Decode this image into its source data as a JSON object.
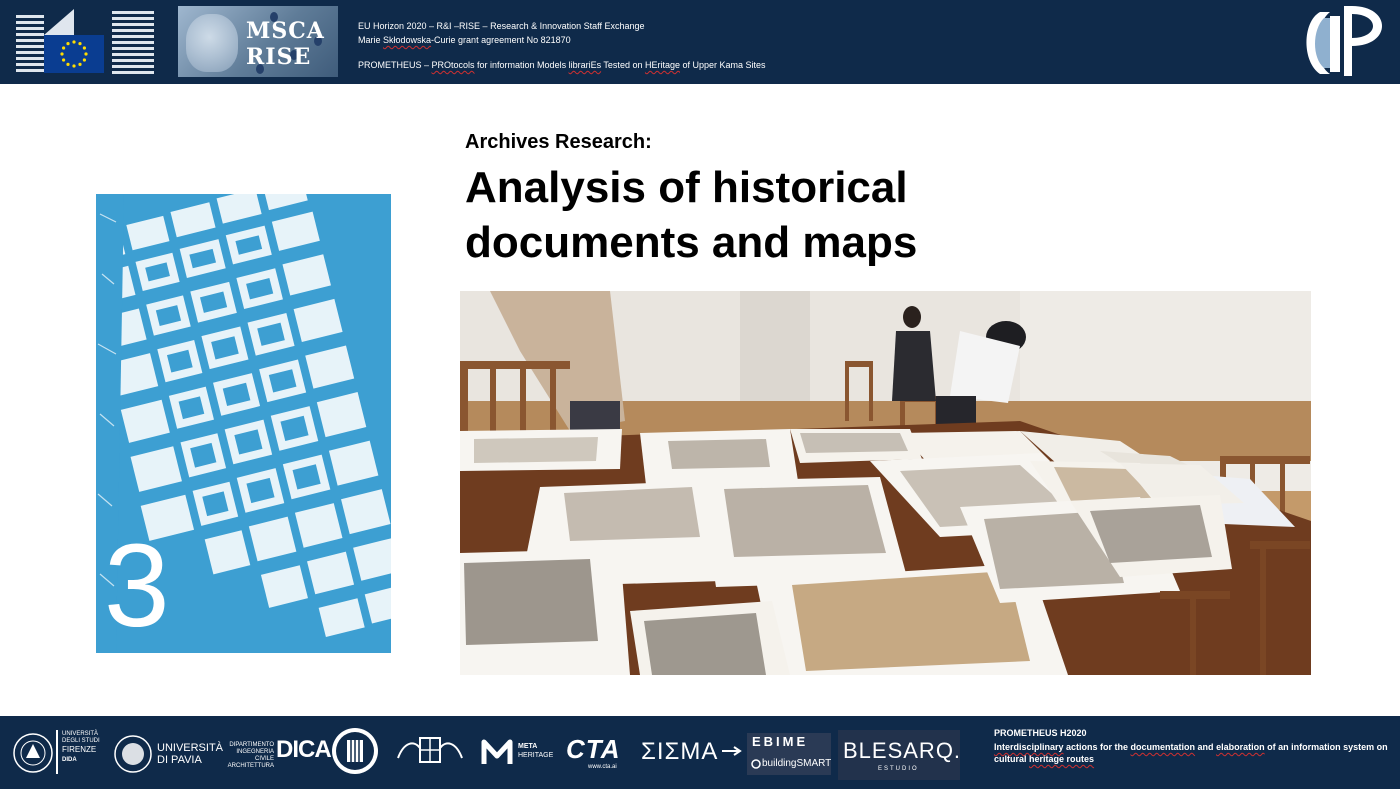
{
  "header": {
    "line1": "EU Horizon 2020 – R&I –RISE – Research & Innovation Staff Exchange",
    "line2_a": "Marie ",
    "line2_b": "Skłodowska",
    "line2_c": "-Curie grant agreement No 821870",
    "line3_a": "PROMETHEUS – ",
    "line3_b": "PROtocols",
    "line3_c": " for information Models ",
    "line3_d": "librariEs",
    "line3_e": " Tested on ",
    "line3_f": "HEritage",
    "line3_g": " of Upper Kama Sites",
    "msca_line1": "MSCA",
    "msca_line2": "RISE",
    "colors": {
      "navy": "#0f2a4a",
      "eu_blue": "#0a3d91",
      "eu_yellow": "#ffdd00"
    }
  },
  "main": {
    "subtitle": "Archives Research:",
    "title": "Analysis of historical documents and maps",
    "map_number": "3",
    "map_color": "#3d9fd2"
  },
  "footer": {
    "title": "PROMETHEUS H2020",
    "desc_a": "Interdisciplinary",
    "desc_b": " actions for the ",
    "desc_c": "documentation",
    "desc_d": " and ",
    "desc_e": "elaboration",
    "desc_f": " of an information system on cultural ",
    "desc_g": "heritage routes",
    "logos": {
      "unifi_1": "UNIVERSITÀ",
      "unifi_2": "DEGLI STUDI",
      "unifi_3": "FIRENZE",
      "unifi_4": "DIDA",
      "unipv_1": "UNIVERSITÀ",
      "unipv_2": "DI PAVIA",
      "dicea_1": "DIPARTIMENTO",
      "dicea_2": "INGEGNERIA",
      "dicea_3": "CIVILE",
      "dicea_4": "ARCHITETTURA",
      "dicea_big": "DICA",
      "meta_1": "META",
      "meta_2": "HERITAGE",
      "cta": "CTA",
      "cta_url": "www.cta.ai",
      "sigma": "ΣΙΣΜΑ",
      "ebime": "EBIME",
      "buildingsmart": "buildingSMART",
      "blesa": "BLESARQ.",
      "blesa_sub": "ESTUDIO"
    }
  }
}
